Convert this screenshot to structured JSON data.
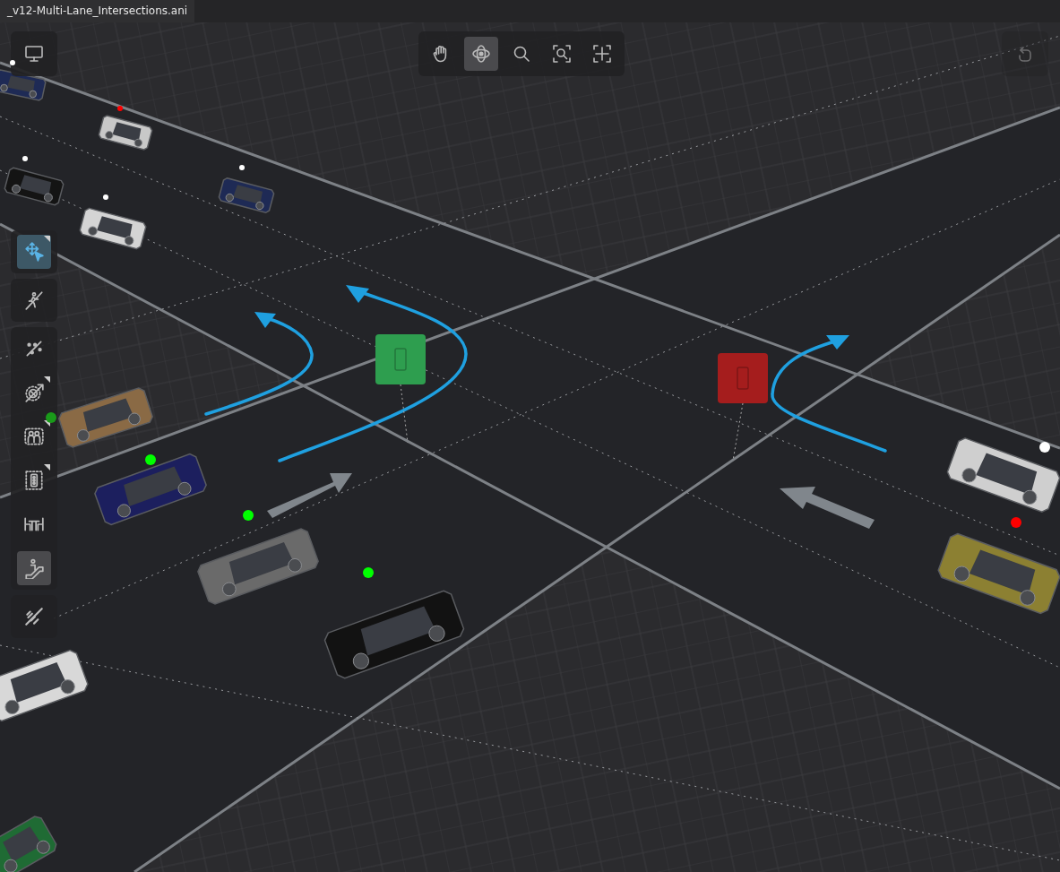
{
  "tab": {
    "title": "_v12-Multi-Lane_Intersections.ani"
  },
  "nav_tools": [
    {
      "kind": "hand",
      "selected": false
    },
    {
      "kind": "orbit",
      "selected": true
    },
    {
      "kind": "zoom",
      "selected": false
    },
    {
      "kind": "zoom-fit",
      "selected": false
    },
    {
      "kind": "frame",
      "selected": false
    }
  ],
  "undo": {
    "disabled": true
  },
  "tool_groups": [
    {
      "tools": [
        {
          "kind": "select-move",
          "selected": true,
          "hovered": false,
          "has_menu": true
        }
      ]
    },
    {
      "tools": [
        {
          "kind": "walk-path",
          "selected": false,
          "hovered": false,
          "has_menu": false
        }
      ]
    },
    {
      "tools": [
        {
          "kind": "points-line",
          "selected": false,
          "hovered": false,
          "has_menu": false
        },
        {
          "kind": "no-entry-path",
          "selected": false,
          "hovered": false,
          "has_menu": true
        },
        {
          "kind": "people-group",
          "selected": false,
          "hovered": false,
          "has_menu": true
        },
        {
          "kind": "traffic-light",
          "selected": false,
          "hovered": false,
          "has_menu": true
        },
        {
          "kind": "table-chairs",
          "selected": false,
          "hovered": false,
          "has_menu": false
        },
        {
          "kind": "escalator",
          "selected": false,
          "hovered": true,
          "has_menu": false
        }
      ]
    },
    {
      "tools": [
        {
          "kind": "crosswalk",
          "selected": false,
          "hovered": false,
          "has_menu": false
        }
      ]
    }
  ],
  "signals": [
    {
      "color": "#2e9e4f"
    },
    {
      "color": "#a51d1d"
    }
  ],
  "cars": [
    {
      "body": {
        "color": "#1e2a55"
      },
      "marker": {
        "color": "#ffffff"
      }
    },
    {
      "body": {
        "color": "#c8c8c8"
      },
      "marker": {
        "color": "#ff0000"
      }
    },
    {
      "body": {
        "color": "#141414"
      },
      "marker": {
        "color": "#ffffff"
      }
    },
    {
      "body": {
        "color": "#1e2a55"
      },
      "marker": {
        "color": "#ffffff"
      }
    },
    {
      "body": {
        "color": "#d4d4d4"
      },
      "marker": {
        "color": "#ffffff"
      }
    },
    {
      "body": {
        "color": "#8a6a45"
      },
      "marker": {
        "color": "#1a9a1a"
      }
    },
    {
      "body": {
        "color": "#1c1f5e"
      },
      "marker": {
        "color": "#00ff00"
      }
    },
    {
      "body": {
        "color": "#6a6a6a"
      },
      "marker": {
        "color": "#00ff00"
      }
    },
    {
      "body": {
        "color": "#121212"
      },
      "marker": {
        "color": "#00ff00"
      }
    },
    {
      "body": {
        "color": "#d8d8d8"
      }
    },
    {
      "body": {
        "color": "#cfcfcf"
      },
      "marker": {
        "color": "#ffffff"
      }
    },
    {
      "body": {
        "color": "#8c8032"
      },
      "marker": {
        "color": "#ff0000"
      }
    },
    {
      "body": {
        "color": "#1f6b34"
      }
    }
  ]
}
